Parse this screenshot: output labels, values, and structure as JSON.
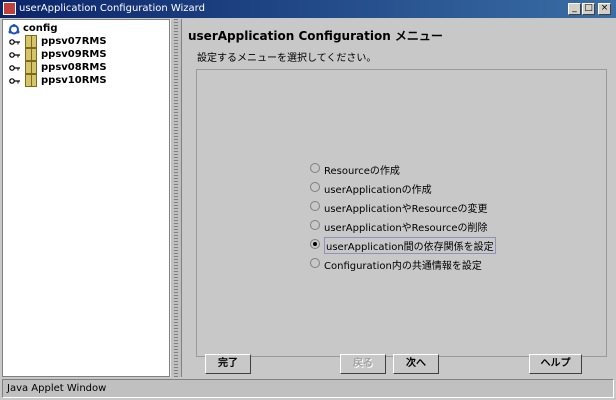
{
  "window": {
    "title": "userApplication Configuration Wizard"
  },
  "tree": {
    "root": "config",
    "nodes": [
      "ppsv07RMS",
      "ppsv09RMS",
      "ppsv08RMS",
      "ppsv10RMS"
    ]
  },
  "main": {
    "title": "userApplication Configuration メニュー",
    "subtitle": "設定するメニューを選択してください。",
    "options": [
      {
        "label": "Resourceの作成",
        "selected": false
      },
      {
        "label": "userApplicationの作成",
        "selected": false
      },
      {
        "label": "userApplicationやResourceの変更",
        "selected": false
      },
      {
        "label": "userApplicationやResourceの削除",
        "selected": false
      },
      {
        "label": "userApplication間の依存関係を設定",
        "selected": true
      },
      {
        "label": "Configuration内の共通情報を設定",
        "selected": false
      }
    ]
  },
  "buttons": {
    "finish": "完了",
    "back": "戻る",
    "next": "次へ",
    "help": "ヘルプ"
  },
  "status": {
    "text": "Java Applet Window"
  },
  "colors": {
    "titlebar": "#0a246a",
    "background": "#c8c8c8",
    "tree_bg": "#ffffff"
  }
}
